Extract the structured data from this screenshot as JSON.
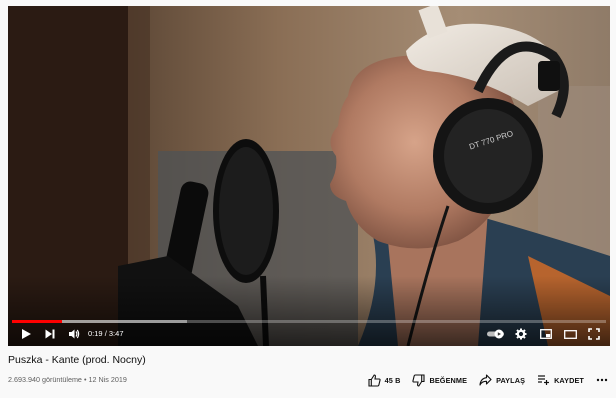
{
  "player": {
    "time_current": "0:19",
    "time_separator": "/",
    "time_total": "3:47",
    "progress_fraction": 0.0837,
    "buffered_fraction": 0.295,
    "headphone_text": "DT 770 PRO"
  },
  "video": {
    "title": "Puszka - Kante (prod. Nocny)",
    "views": "2.693.940 görüntüleme",
    "separator": "•",
    "date": "12 Nis 2019"
  },
  "actions": {
    "like_count": "45 B",
    "dislike_label": "BEĞENME",
    "share_label": "PAYLAŞ",
    "save_label": "KAYDET"
  },
  "colors": {
    "progress": "#ff0000",
    "text_primary": "#0f0f0f",
    "text_secondary": "#606060"
  },
  "icons": [
    "play-icon",
    "next-icon",
    "volume-icon",
    "autoplay-toggle-icon",
    "settings-icon",
    "miniplayer-icon",
    "theater-icon",
    "fullscreen-icon",
    "like-icon",
    "dislike-icon",
    "share-icon",
    "save-icon",
    "more-icon"
  ]
}
